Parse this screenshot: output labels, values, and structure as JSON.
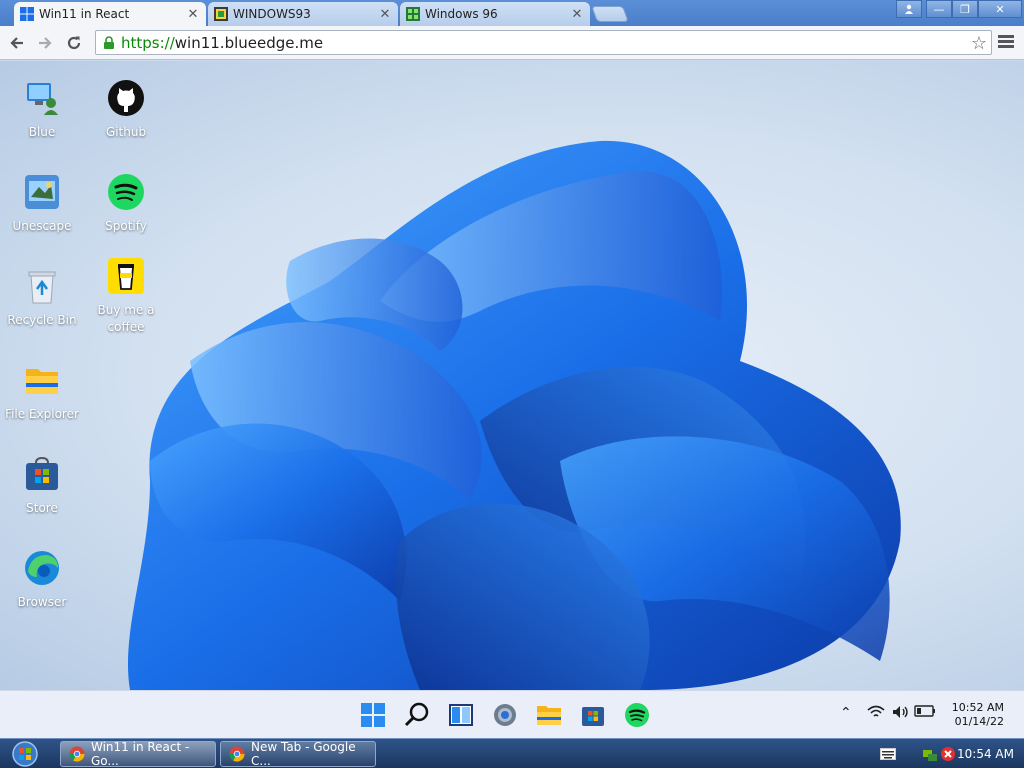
{
  "browser": {
    "tabs": [
      {
        "title": "Win11 in React",
        "active": true
      },
      {
        "title": "WINDOWS93",
        "active": false
      },
      {
        "title": "Windows 96",
        "active": false
      }
    ],
    "url_protocol": "https://",
    "url_host": "win11.blueedge.me"
  },
  "desktop": {
    "icons": [
      {
        "label": "Blue",
        "icon": "blue-user-icon"
      },
      {
        "label": "Github",
        "icon": "github-icon"
      },
      {
        "label": "Unescape",
        "icon": "unescape-icon"
      },
      {
        "label": "Spotify",
        "icon": "spotify-icon"
      },
      {
        "label": "Recycle Bin",
        "icon": "recycle-bin-icon"
      },
      {
        "label": "Buy me a coffee",
        "icon": "coffee-icon"
      },
      {
        "label": "File Explorer",
        "icon": "folder-icon"
      },
      {
        "label": "Store",
        "icon": "store-icon"
      },
      {
        "label": "Browser",
        "icon": "edge-icon"
      }
    ]
  },
  "win11_taskbar": {
    "time": "10:52 AM",
    "date": "01/14/22"
  },
  "host_taskbar": {
    "tasks": [
      {
        "title": "Win11 in React - Go...",
        "active": true
      },
      {
        "title": "New Tab - Google C...",
        "active": false
      }
    ],
    "time": "10:54 AM"
  },
  "colors": {
    "accent": "#1a6ee8",
    "spotify": "#1ed760",
    "url_green": "#0a8a0a"
  }
}
